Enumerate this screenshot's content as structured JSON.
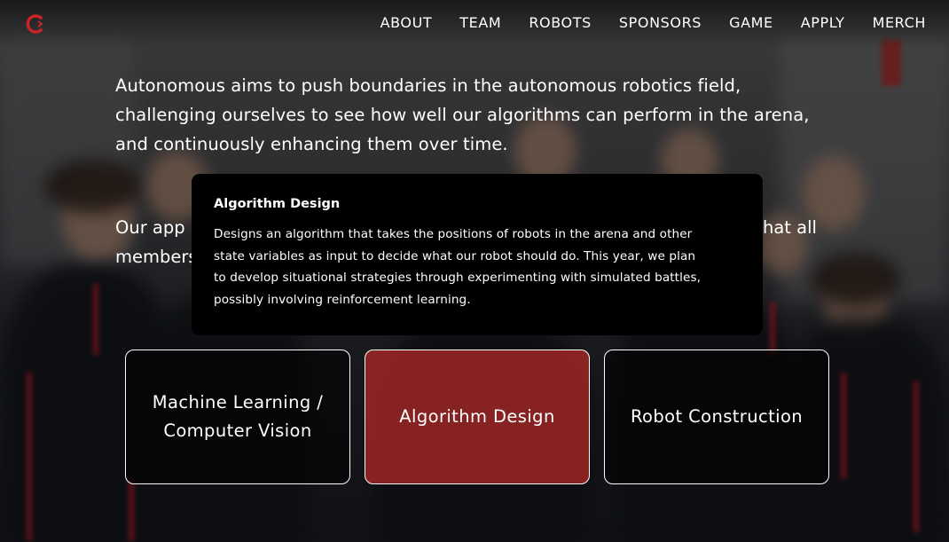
{
  "nav": {
    "logo_icon": "team-logo-icon",
    "accent_color": "#c8252b",
    "items": [
      {
        "label": "ABOUT"
      },
      {
        "label": "TEAM"
      },
      {
        "label": "ROBOTS"
      },
      {
        "label": "SPONSORS"
      },
      {
        "label": "GAME"
      },
      {
        "label": "APPLY"
      },
      {
        "label": "MERCH"
      }
    ]
  },
  "intro": {
    "line1": "Autonomous aims to push boundaries in the autonomous robotics field,",
    "line2": "challenging ourselves to see how well our algorithms can perform in the arena,",
    "line3": "and continuously enhancing them over time."
  },
  "approach": {
    "line1_start": "Our app",
    "line1_end": "hat all",
    "line2_start": "members"
  },
  "tooltip": {
    "title": "Algorithm Design",
    "body_lines": [
      "Designs an algorithm that takes the positions of robots in the arena and other",
      "state variables as input to decide what our robot should do. This year, we plan",
      "to develop situational strategies through experimenting with simulated battles,",
      "possibly involving reinforcement learning."
    ]
  },
  "cards": [
    {
      "line1": "Machine Learning /",
      "line2": "Computer Vision",
      "active": false
    },
    {
      "line1": "Algorithm Design",
      "active": true,
      "highlight_color": "#a82828"
    },
    {
      "line1": "Robot Construction",
      "active": false
    }
  ]
}
